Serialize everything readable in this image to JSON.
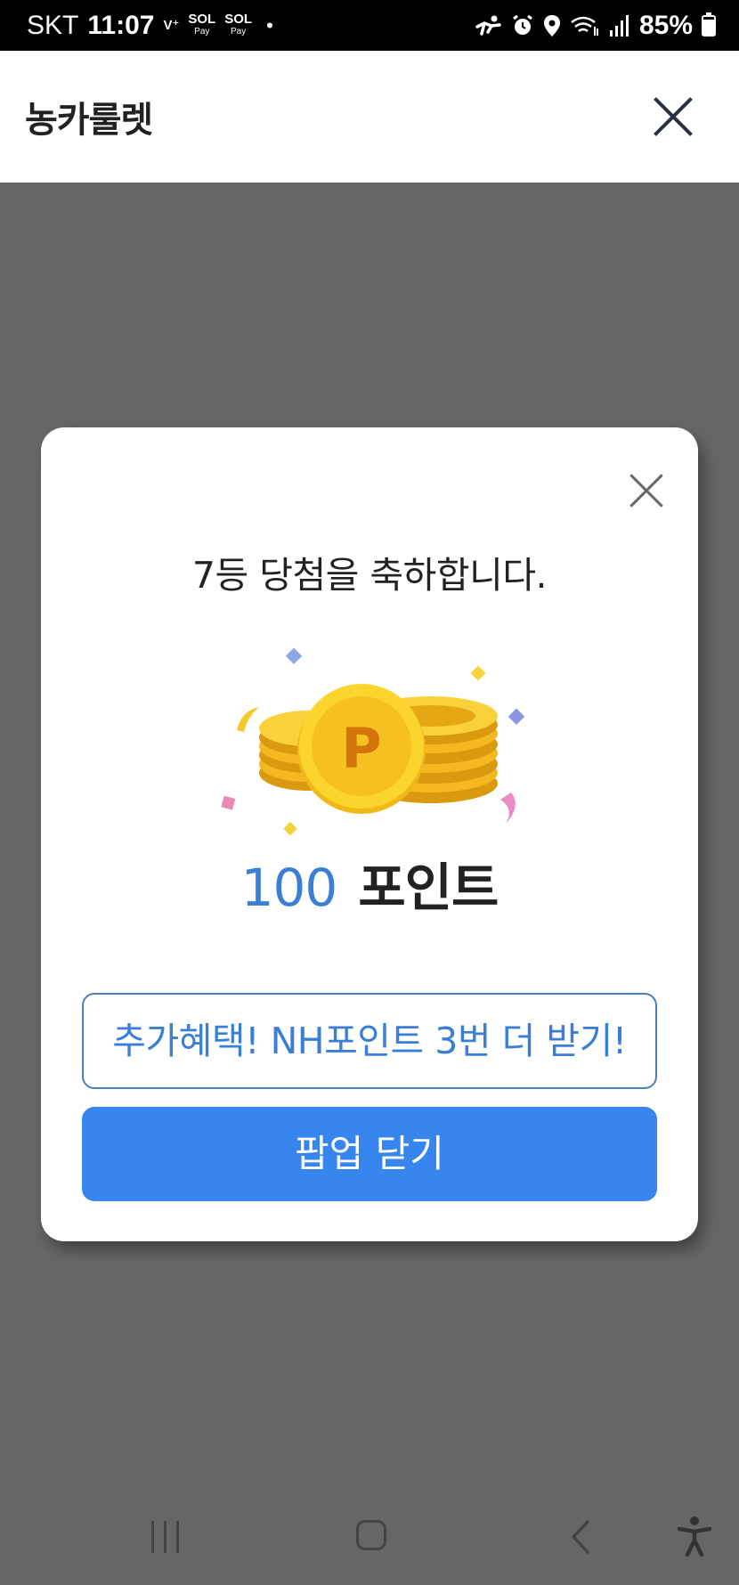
{
  "status_bar": {
    "carrier": "SKT",
    "time": "11:07",
    "icons_left": [
      {
        "name": "volte-icon",
        "label": "V⁺"
      },
      {
        "name": "sol-pay-icon",
        "label": "SOL",
        "sub": "Pay"
      },
      {
        "name": "sol-pay-icon-2",
        "label": "SOL",
        "sub": "Pay"
      }
    ],
    "dot": "•",
    "battery_percent": "85%",
    "battery_level": 0.85
  },
  "header": {
    "title": "농카룰렛"
  },
  "modal": {
    "message": "7등 당첨을 축하합니다.",
    "points_value": "100",
    "points_unit": "포인트",
    "coin_letter": "P",
    "benefit_button_label": "추가혜택! NH포인트 3번 더 받기!",
    "close_button_label": "팝업 닫기"
  },
  "colors": {
    "accent_blue": "#3786f0",
    "text_blue": "#3a7fd5",
    "overlay_gray": "#666666",
    "coin_gold": "#f5c518"
  }
}
